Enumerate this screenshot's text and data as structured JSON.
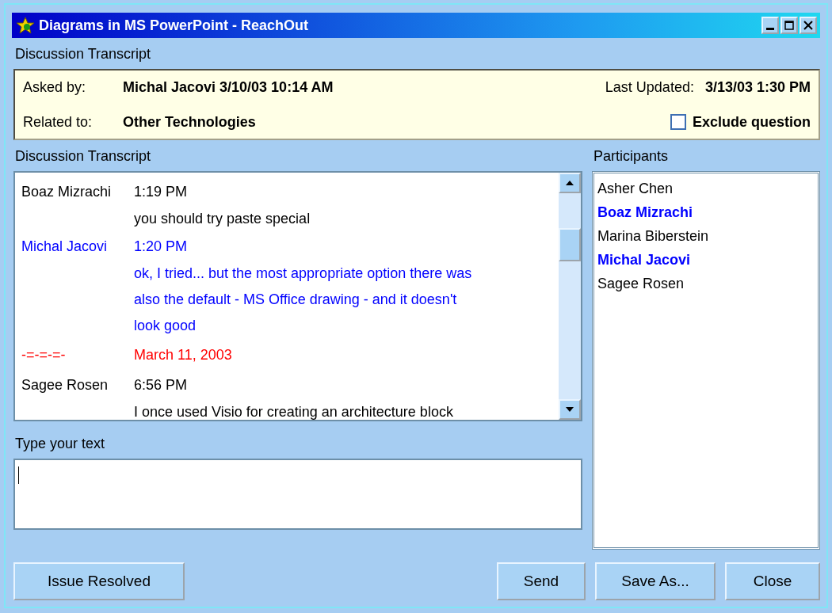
{
  "window": {
    "title": "Diagrams in MS PowerPoint  - ReachOut"
  },
  "header": {
    "label": "Discussion Transcript",
    "asked_by_label": "Asked by:",
    "asked_by": "Michal Jacovi  3/10/03 10:14 AM",
    "last_updated_label": "Last Updated:",
    "last_updated": "3/13/03 1:30 PM",
    "related_label": "Related to:",
    "related": "Other Technologies",
    "exclude": {
      "label": "Exclude question",
      "checked": false
    }
  },
  "transcript": {
    "label": "Discussion Transcript",
    "entries": [
      {
        "kind": "message",
        "author": "Boaz Mizrachi",
        "time": "1:19 PM",
        "lines": [
          "you should try paste special"
        ],
        "color": "#000000"
      },
      {
        "kind": "message",
        "author": "Michal Jacovi",
        "time": "1:20 PM",
        "lines": [
          "ok, I tried... but the most appropriate option there was",
          "also the default - MS Office drawing - and it doesn't",
          "look good"
        ],
        "color": "#0000ff"
      },
      {
        "kind": "date",
        "author": "-=-=-=-",
        "time": "March 11, 2003",
        "color": "#ff0000"
      },
      {
        "kind": "message",
        "author": "Sagee Rosen",
        "time": "6:56 PM",
        "lines": [
          "I once used Visio for creating an architecture block"
        ],
        "color": "#000000"
      }
    ]
  },
  "participants": {
    "label": "Participants",
    "items": [
      {
        "name": "Asher Chen",
        "highlighted": false
      },
      {
        "name": "Boaz Mizrachi",
        "highlighted": true
      },
      {
        "name": "Marina Biberstein",
        "highlighted": false
      },
      {
        "name": "Michal Jacovi",
        "highlighted": true
      },
      {
        "name": "Sagee Rosen",
        "highlighted": false
      }
    ]
  },
  "input": {
    "label": "Type your text"
  },
  "buttons": {
    "resolve": "Issue Resolved",
    "send": "Send",
    "save": "Save As...",
    "close": "Close"
  }
}
